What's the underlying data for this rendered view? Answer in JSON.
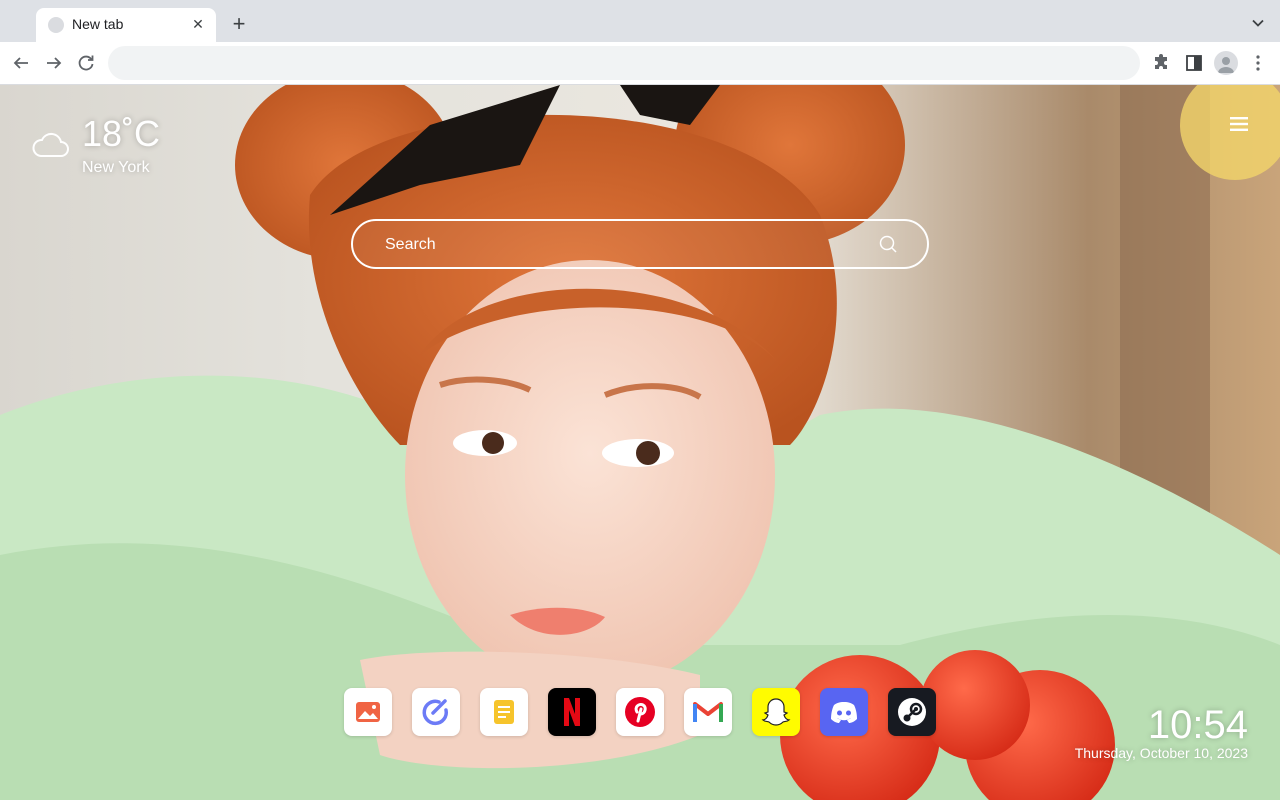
{
  "browser": {
    "tab": {
      "title": "New tab",
      "close_icon": "close-icon"
    },
    "new_tab_icon": "plus-icon",
    "tab_search_icon": "chevron-down-icon",
    "nav": {
      "back_icon": "arrow-left-icon",
      "forward_icon": "arrow-right-icon",
      "reload_icon": "reload-icon"
    },
    "omnibox": {
      "value": "",
      "placeholder": ""
    },
    "extensions_icon": "puzzle-icon",
    "side_panel_icon": "side-panel-icon",
    "profile_icon": "avatar-icon",
    "menu_icon": "kebab-icon"
  },
  "weather": {
    "temperature": "18˚C",
    "city": "New York",
    "icon": "cloud-icon"
  },
  "menu_icon": "hamburger-icon",
  "search": {
    "placeholder": "Search",
    "icon": "search-icon"
  },
  "apps": [
    {
      "name": "photos",
      "icon": "image-icon",
      "bg": "#ffffff",
      "accent": "#f06444"
    },
    {
      "name": "todo",
      "icon": "check-circle-icon",
      "bg": "#ffffff",
      "accent": "#6c7bf6"
    },
    {
      "name": "notes",
      "icon": "notepad-icon",
      "bg": "#ffffff",
      "accent": "#f6c42b"
    },
    {
      "name": "netflix",
      "icon": "netflix-icon",
      "bg": "#000000",
      "accent": "#e50914"
    },
    {
      "name": "pinterest",
      "icon": "pinterest-icon",
      "bg": "#ffffff",
      "accent": "#e60023"
    },
    {
      "name": "gmail",
      "icon": "gmail-icon",
      "bg": "#ffffff",
      "accent": "#ea4335"
    },
    {
      "name": "snapchat",
      "icon": "snapchat-icon",
      "bg": "#fffc00",
      "accent": "#ffffff"
    },
    {
      "name": "discord",
      "icon": "discord-icon",
      "bg": "#5865f2",
      "accent": "#ffffff"
    },
    {
      "name": "steam",
      "icon": "steam-icon",
      "bg": "#171a21",
      "accent": "#ffffff"
    }
  ],
  "clock": {
    "time": "10:54",
    "date": "Thursday, October 10, 2023"
  }
}
